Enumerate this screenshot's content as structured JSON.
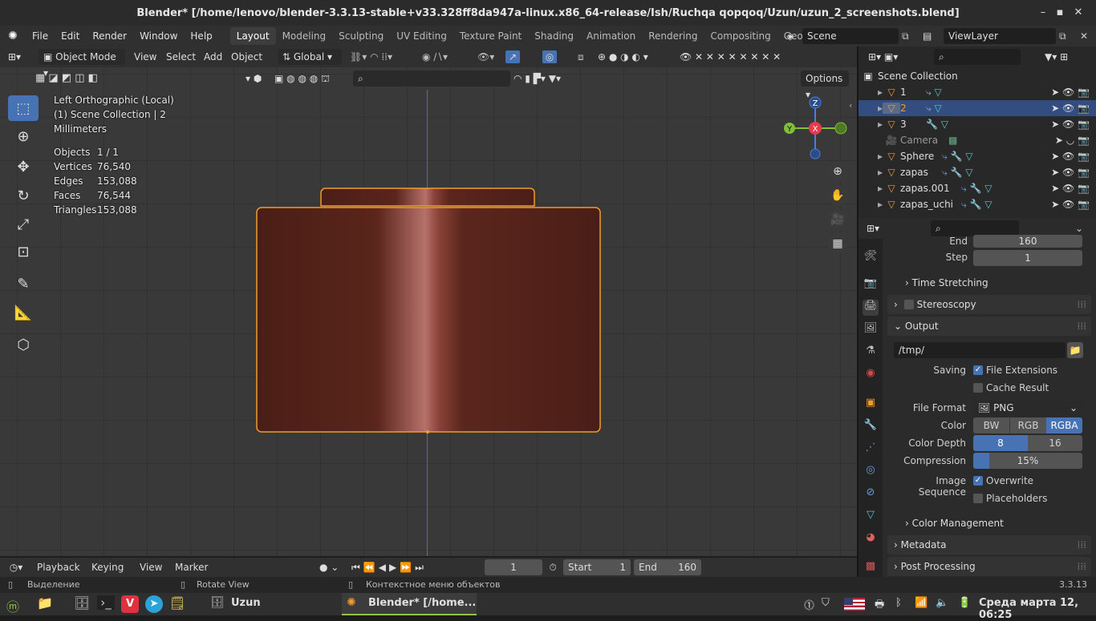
{
  "window": {
    "title": "Blender* [/home/lenovo/blender-3.3.13-stable+v33.328ff8da947a-linux.x86_64-release/Ish/Ruchqa qopqoq/Uzun/uzun_2_screenshots.blend]"
  },
  "menu": {
    "items": [
      "File",
      "Edit",
      "Render",
      "Window",
      "Help"
    ]
  },
  "workspaces": [
    "Layout",
    "Modeling",
    "Sculpting",
    "UV Editing",
    "Texture Paint",
    "Shading",
    "Animation",
    "Rendering",
    "Compositing",
    "Geometry Noc"
  ],
  "scene": {
    "name": "Scene",
    "view_layer": "ViewLayer"
  },
  "viewport_header": {
    "mode": "Object Mode",
    "menus": [
      "View",
      "Select",
      "Add",
      "Object"
    ],
    "orientation": "Global",
    "options": "Options"
  },
  "overlay": {
    "view_name": "Left Orthographic (Local)",
    "collection": "(1) Scene Collection | 2",
    "units": "Millimeters",
    "stats": [
      {
        "label": "Objects",
        "value": "1 / 1"
      },
      {
        "label": "Vertices",
        "value": "76,540"
      },
      {
        "label": "Edges",
        "value": "153,088"
      },
      {
        "label": "Faces",
        "value": "76,544"
      },
      {
        "label": "Triangles",
        "value": "153,088"
      }
    ]
  },
  "gizmo": {
    "z": "Z",
    "y": "Y",
    "x": "X"
  },
  "outliner": {
    "root": "Scene Collection",
    "items": [
      {
        "name": "1",
        "selected": false
      },
      {
        "name": "2",
        "selected": true
      },
      {
        "name": "3",
        "selected": false
      },
      {
        "name": "Camera",
        "selected": false
      },
      {
        "name": "Sphere",
        "selected": false
      },
      {
        "name": "zapas",
        "selected": false
      },
      {
        "name": "zapas.001",
        "selected": false
      },
      {
        "name": "zapas_uchi",
        "selected": false
      }
    ]
  },
  "properties": {
    "end_label": "End",
    "end_value": "160",
    "step_label": "Step",
    "step_value": "1",
    "time_stretching": "Time Stretching",
    "stereoscopy": "Stereoscopy",
    "output": "Output",
    "path": "/tmp/",
    "saving_label": "Saving",
    "file_extensions": "File Extensions",
    "cache_result": "Cache Result",
    "file_format_label": "File Format",
    "file_format": "PNG",
    "color_label": "Color",
    "color_opts": [
      "BW",
      "RGB",
      "RGBA"
    ],
    "depth_label": "Color Depth",
    "depth_opts": [
      "8",
      "16"
    ],
    "compression_label": "Compression",
    "compression": "15%",
    "image_seq_label": "Image Sequence",
    "overwrite": "Overwrite",
    "placeholders": "Placeholders",
    "color_management": "Color Management",
    "metadata": "Metadata",
    "post_processing": "Post Processing"
  },
  "timeline": {
    "playback": "Playback",
    "keying": "Keying",
    "view": "View",
    "marker": "Marker",
    "frame": "1",
    "start_label": "Start",
    "start": "1",
    "end_label": "End",
    "end": "160"
  },
  "status": {
    "select": "Выделение",
    "rotate": "Rotate View",
    "context": "Контекстное меню объектов",
    "version": "3.3.13"
  },
  "taskbar": {
    "folder": "Uzun",
    "blender": "Blender* [/home...",
    "datetime": "Среда марта 12, 06:25"
  }
}
